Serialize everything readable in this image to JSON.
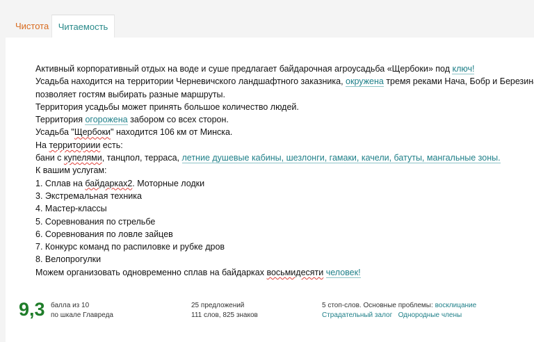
{
  "tabs": [
    {
      "label": "Чистота",
      "color": "#d86a1e"
    },
    {
      "label": "Читаемость",
      "active": true,
      "color": "#2a8a8a"
    }
  ],
  "text": {
    "l1": {
      "a": "Активный корпоративный отдых на воде и суше предлагает байдарочная агроусадьба «Щербоки» под ",
      "b": "ключ!"
    },
    "l2": {
      "a": "Усадьба находится на территории Черневичского ландшафтного заказника, ",
      "b": "окружена",
      "c": " тремя реками Нача, Бобр и Березина. Это"
    },
    "l3": "позволяет гостям выбирать разные маршруты.",
    "l4": "Территория усадьбы может принять большое количество людей.",
    "l5": {
      "a": "Территория ",
      "b": "огорожена",
      "c": " забором со всех сторон."
    },
    "l6": {
      "a": "Усадьба \"",
      "b": "Щербоки",
      "c": "\" находится 106 км от Минска."
    },
    "l7": {
      "a": "На ",
      "b": "территориии",
      "c": " есть:"
    },
    "l8": {
      "a": "бани с ",
      "b": "купелями",
      "c": ", танцпол, терраса, ",
      "d": "летние душевые кабины, шезлонги, гамаки, качели, батуты, мангальные зоны."
    },
    "l9": "К вашим услугам:",
    "l10": {
      "a": "1. Сплав на ",
      "b": "байдарках2",
      "c": ". Моторные лодки"
    },
    "l11": "3. Экстремальная техника",
    "l12": "4. Мастер-классы",
    "l13": "5. Соревнования по стрельбе",
    "l14": "6. Соревнования по ловле зайцев",
    "l15": "7. Конкурс команд по распиловке и рубке дров",
    "l16": "8. Велопрогулки",
    "l17": {
      "a": "Можем организовать одновременно сплав на байдарках ",
      "b": "восьмидесяти",
      "c": " ",
      "d": "человек!"
    }
  },
  "score": {
    "value": "9,3",
    "line1": "балла из 10",
    "line2": "по шкале Главреда",
    "color": "#1f7d2a"
  },
  "stats": {
    "sentences": "25 предложений",
    "words": "111 слов, 825 знаков"
  },
  "problems": {
    "prefix": "5 стоп-слов. Основные проблемы: ",
    "link1": "восклицание",
    "link2": "Страдательный залог",
    "link3": "Однородные члены",
    "link_color": "#1e7f88"
  }
}
